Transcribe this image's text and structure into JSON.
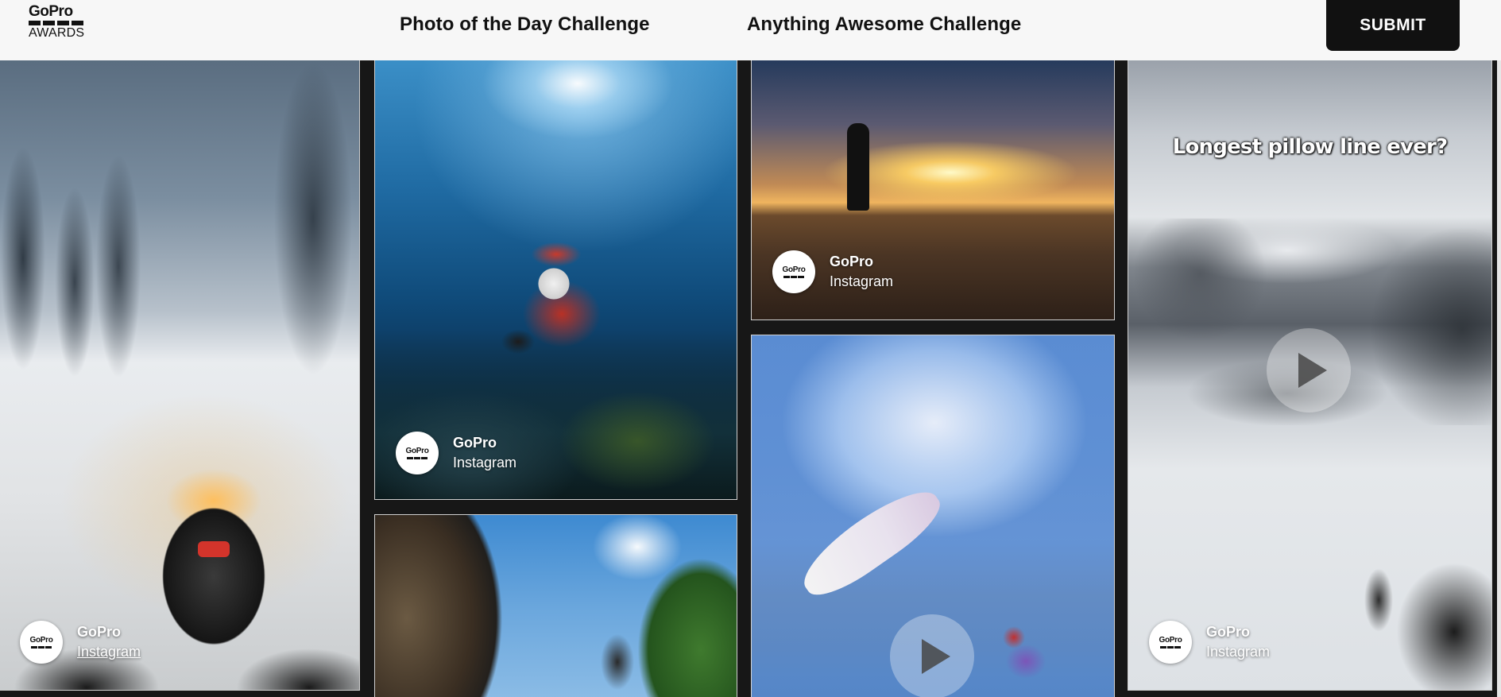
{
  "header": {
    "logo": {
      "brand": "GoPro",
      "sub": "AWARDS"
    },
    "nav": [
      {
        "label": "Photo of the Day Challenge"
      },
      {
        "label": "Anything Awesome Challenge"
      }
    ],
    "submit_label": "SUBMIT"
  },
  "gallery": {
    "avatar_text": "GoPro",
    "cards": [
      {
        "credit_name": "GoPro",
        "credit_source": "Instagram",
        "media": "video-snowmobile"
      },
      {
        "credit_name": "GoPro",
        "credit_source": "Instagram",
        "media": "photo-underwater-santa"
      },
      {
        "media": "photo-dirt-bike"
      },
      {
        "credit_name": "GoPro",
        "credit_source": "Instagram",
        "media": "photo-salt-flat-sunset"
      },
      {
        "media": "video-paraglider",
        "has_play": true
      },
      {
        "credit_name": "GoPro",
        "credit_source": "Instagram",
        "media": "video-snowboard",
        "caption": "Longest pillow line ever?",
        "has_play": true
      }
    ]
  }
}
